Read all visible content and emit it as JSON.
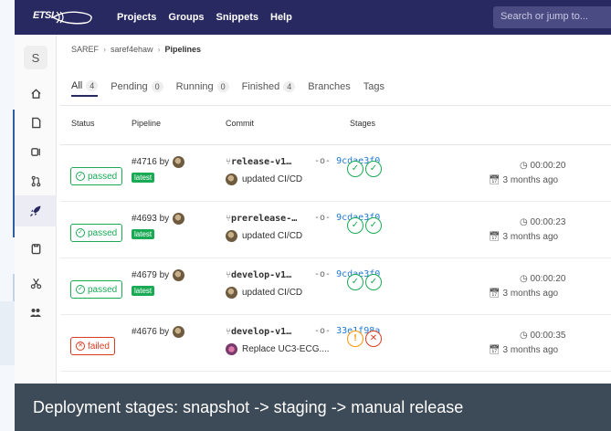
{
  "navbar": {
    "logo_text": "ETSI",
    "links": [
      "Projects",
      "Groups",
      "Snippets",
      "Help"
    ],
    "search_placeholder": "Search or jump to..."
  },
  "sidebar": {
    "project_initial": "S",
    "icons": [
      "home-icon",
      "document-icon",
      "issues-icon",
      "merge-request-icon",
      "rocket-icon",
      "clipboard-icon",
      "scissors-icon",
      "members-icon"
    ],
    "active": "rocket-icon"
  },
  "breadcrumb": {
    "group": "SAREF",
    "project": "saref4ehaw",
    "current": "Pipelines"
  },
  "tabs": [
    {
      "label": "All",
      "count": "4"
    },
    {
      "label": "Pending",
      "count": "0"
    },
    {
      "label": "Running",
      "count": "0"
    },
    {
      "label": "Finished",
      "count": "4"
    },
    {
      "label": "Branches",
      "count": ""
    },
    {
      "label": "Tags",
      "count": ""
    }
  ],
  "columns": {
    "status": "Status",
    "pipeline": "Pipeline",
    "commit": "Commit",
    "stages": "Stages"
  },
  "rows": [
    {
      "status": "passed",
      "pipeline": "#4716 by",
      "latest": "latest",
      "branch": "release-v1…",
      "sha": "9cdae3f0",
      "message": "updated CI/CD",
      "duration": "00:00:20",
      "finished": "3 months ago",
      "stage_states": [
        "success",
        "success"
      ]
    },
    {
      "status": "passed",
      "pipeline": "#4693 by",
      "latest": "latest",
      "branch": "prerelease-…",
      "sha": "9cdae3f0",
      "message": "updated CI/CD",
      "duration": "00:00:23",
      "finished": "3 months ago",
      "stage_states": [
        "success",
        "success"
      ]
    },
    {
      "status": "passed",
      "pipeline": "#4679 by",
      "latest": "latest",
      "branch": "develop-v1…",
      "sha": "9cdae3f0",
      "message": "updated CI/CD",
      "duration": "00:00:20",
      "finished": "3 months ago",
      "stage_states": [
        "success",
        "success"
      ]
    },
    {
      "status": "failed",
      "pipeline": "#4676 by",
      "latest": "",
      "branch": "develop-v1…",
      "sha": "33e1f98a",
      "message": "Replace UC3-ECG....",
      "duration": "00:00:35",
      "finished": "3 months ago",
      "stage_states": [
        "warning",
        "failed"
      ]
    }
  ],
  "caption": "Deployment stages:  snapshot -> staging -> manual release",
  "colors": {
    "navbar": "#292961",
    "success": "#1aaa55",
    "failed": "#db3b21",
    "warning": "#fc9403",
    "link": "#1f78d1",
    "caption_bg": "#3d4a58"
  }
}
